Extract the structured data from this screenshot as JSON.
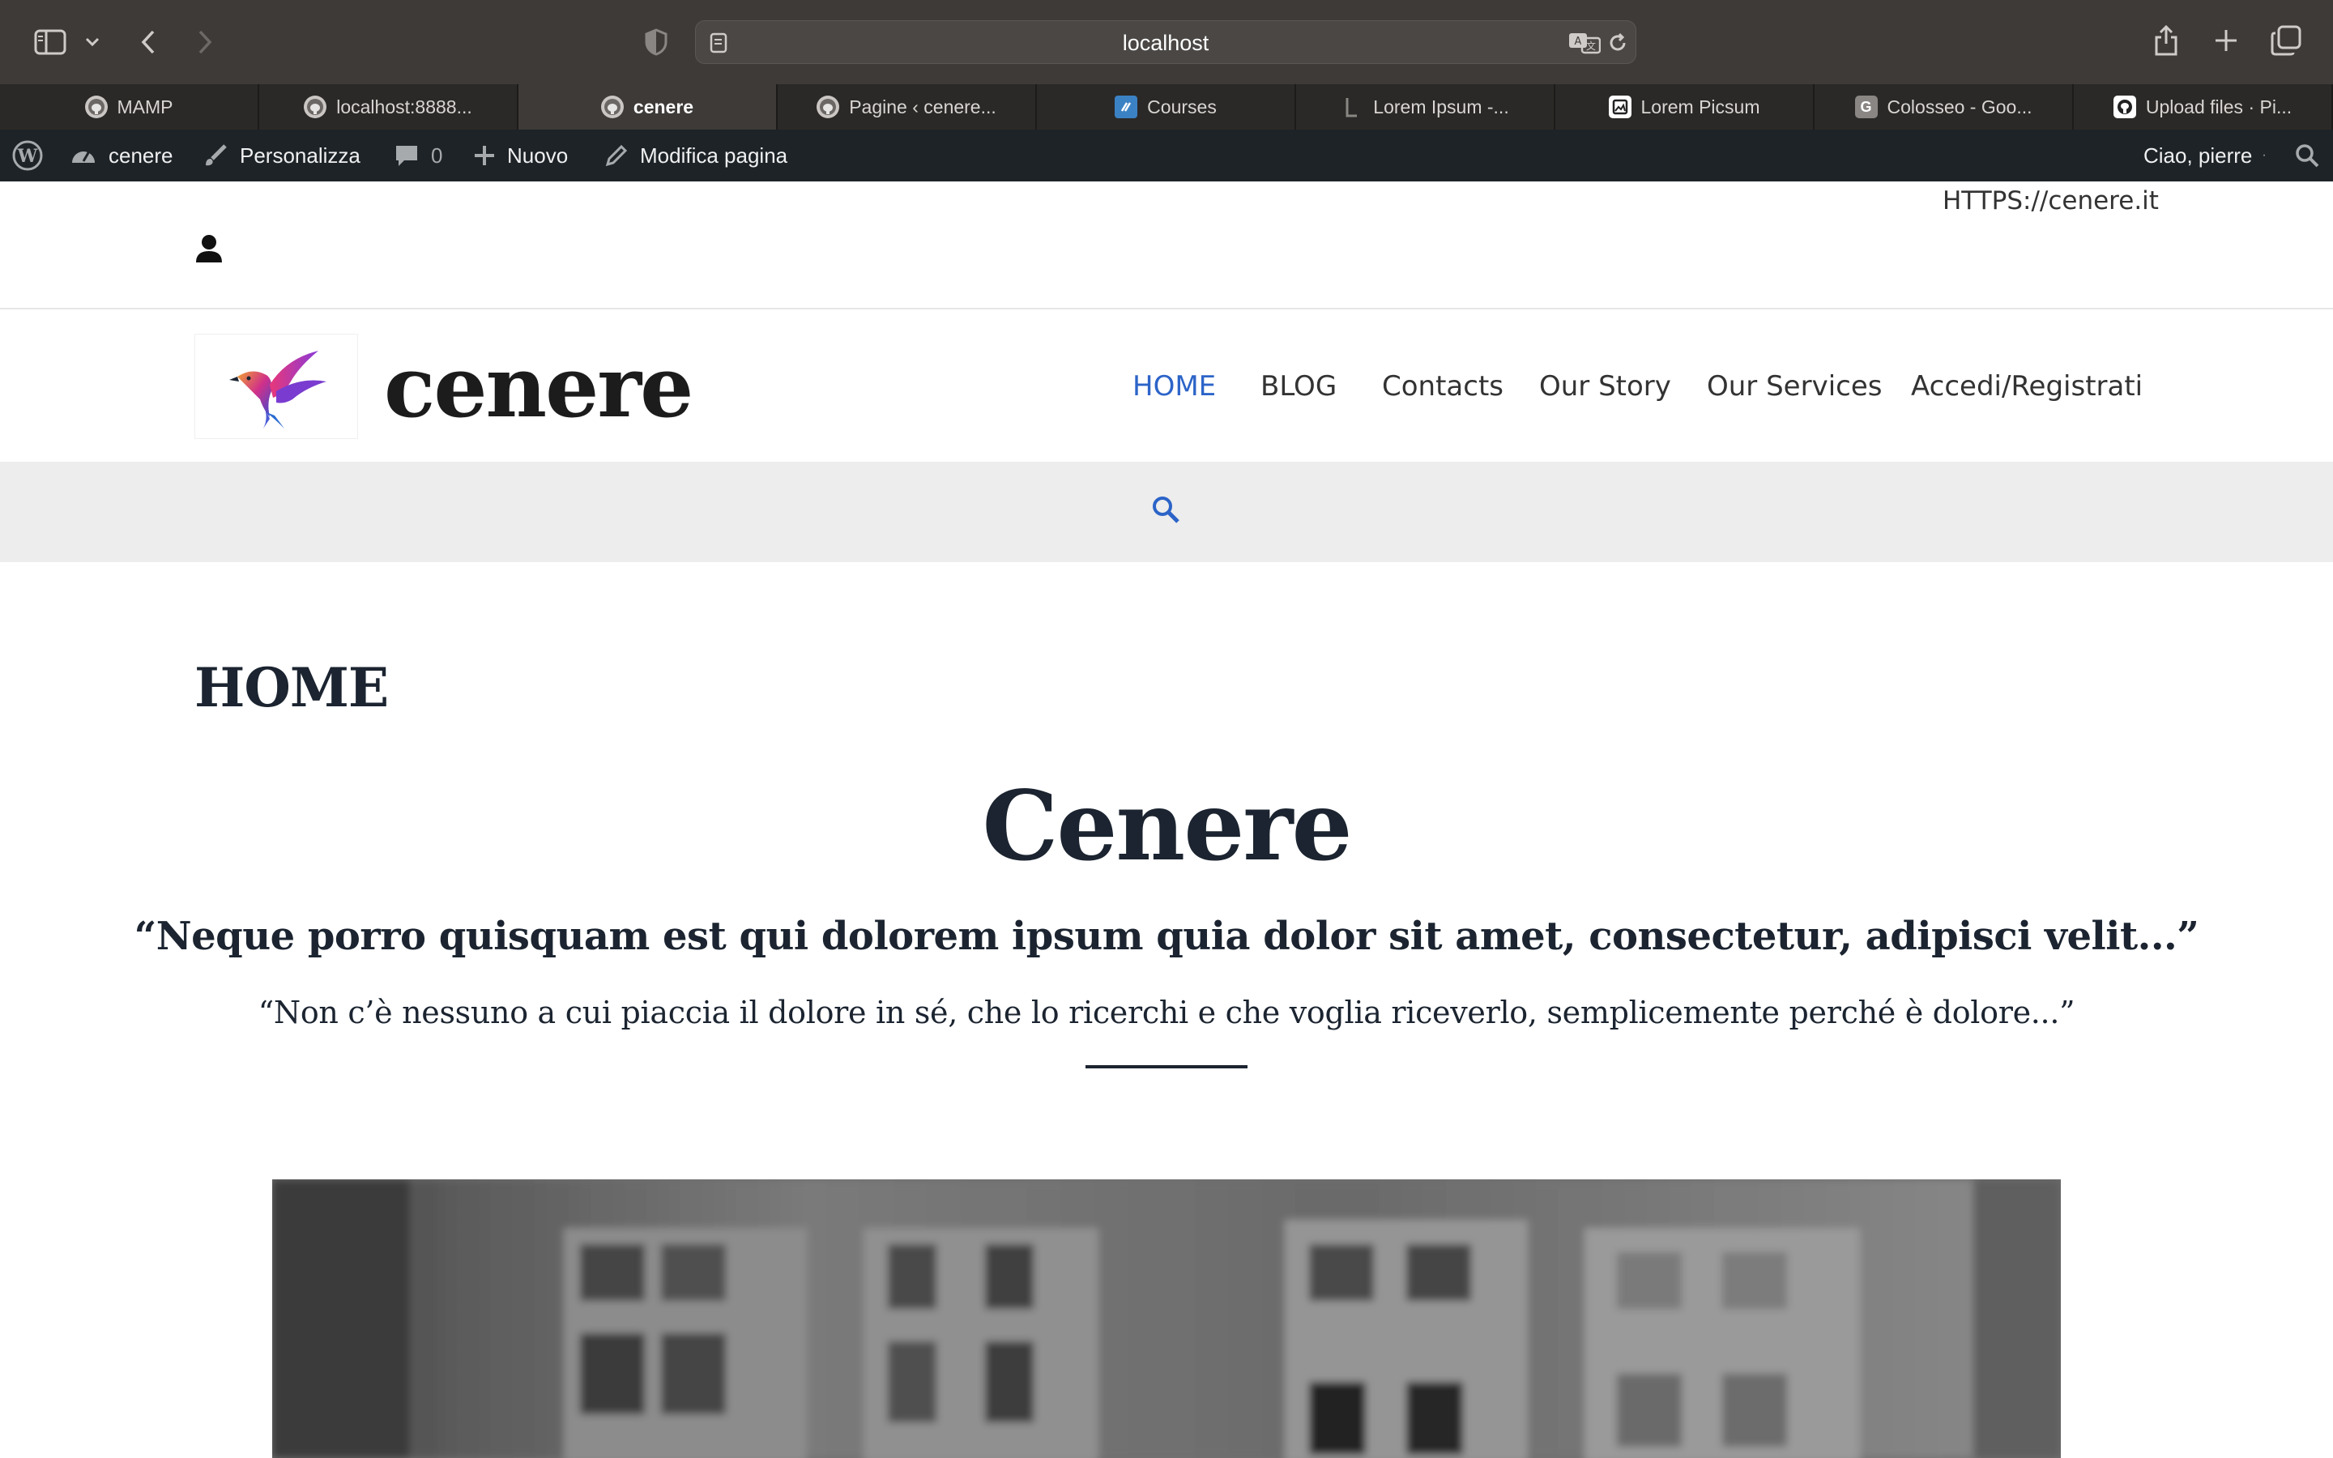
{
  "browser": {
    "address": "localhost",
    "tabs": [
      {
        "label": "MAMP",
        "active": false,
        "favicon": "mamp-elephant-icon"
      },
      {
        "label": "localhost:8888...",
        "active": false,
        "favicon": "mamp-elephant-icon"
      },
      {
        "label": "cenere",
        "active": true,
        "favicon": "mamp-elephant-icon"
      },
      {
        "label": "Pagine ‹ cenere...",
        "active": false,
        "favicon": "mamp-elephant-icon"
      },
      {
        "label": "Courses",
        "active": false,
        "favicon": "courses-icon"
      },
      {
        "label": "Lorem Ipsum -...",
        "active": false,
        "favicon": "lorem-ipsum-icon"
      },
      {
        "label": "Lorem Picsum",
        "active": false,
        "favicon": "picsum-icon"
      },
      {
        "label": "Colosseo - Goo...",
        "active": false,
        "favicon": "g-icon"
      },
      {
        "label": "Upload files · Pi...",
        "active": false,
        "favicon": "github-icon"
      }
    ]
  },
  "adminbar": {
    "site_name": "cenere",
    "customize": "Personalizza",
    "comments_count": "0",
    "new": "Nuovo",
    "edit_page": "Modifica pagina",
    "greeting": "Ciao, pierre"
  },
  "site": {
    "url_text": "HTTPS://cenere.it",
    "title": "cenere",
    "nav": [
      {
        "label": "HOME",
        "active": true
      },
      {
        "label": "BLOG",
        "active": false
      },
      {
        "label": "Contacts",
        "active": false
      },
      {
        "label": "Our Story",
        "active": false
      },
      {
        "label": "Our Services",
        "active": false
      },
      {
        "label": "Accedi/Registrati",
        "active": false
      }
    ],
    "accent": "#2c64c8"
  },
  "content": {
    "page_heading": "HOME",
    "hero_title": "Cenere",
    "quote_latin": "“Neque porro quisquam est qui dolorem ipsum quia dolor sit amet, consectetur, adipisci velit...”",
    "quote_italian": "“Non c’è nessuno a cui piaccia il dolore in sé, che lo ricerchi e che voglia riceverlo, semplicemente perché è dolore...”"
  }
}
